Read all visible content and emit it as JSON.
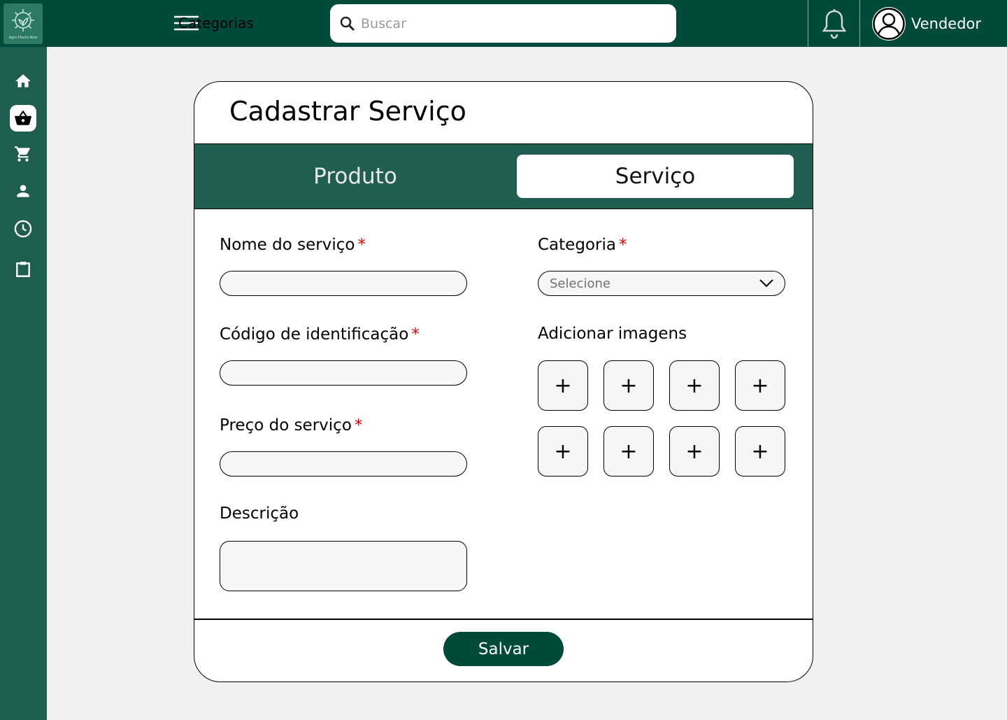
{
  "topbar": {
    "logo_text": "Agro Plants Now",
    "categories_label": "Categorias",
    "search_placeholder": "Buscar",
    "user_name": "Vendedor"
  },
  "sidebar": {
    "items": [
      {
        "icon": "home-icon"
      },
      {
        "icon": "shopping-basket-icon",
        "active": true
      },
      {
        "icon": "cart-icon"
      },
      {
        "icon": "person-icon"
      },
      {
        "icon": "clock-icon"
      },
      {
        "icon": "clipboard-icon"
      }
    ]
  },
  "form": {
    "title": "Cadastrar Serviço",
    "tabs": [
      {
        "label": "Produto",
        "active": false
      },
      {
        "label": "Serviço",
        "active": true
      }
    ],
    "required_mark": "*",
    "fields": {
      "nome": {
        "label": "Nome do serviço",
        "value": ""
      },
      "codigo": {
        "label": "Código de identificação",
        "value": ""
      },
      "preco": {
        "label": "Preço do serviço",
        "value": ""
      },
      "descricao": {
        "label": "Descrição",
        "value": ""
      },
      "categoria": {
        "label": "Categoria",
        "selected": "Selecione"
      }
    },
    "images": {
      "label": "Adicionar imagens",
      "slot_symbol": "+"
    },
    "save_label": "Salvar"
  },
  "colors": {
    "topbar": "#004a3a",
    "sidebar": "#1e5e4f",
    "tabbar": "#215e52",
    "required": "#e00000"
  }
}
